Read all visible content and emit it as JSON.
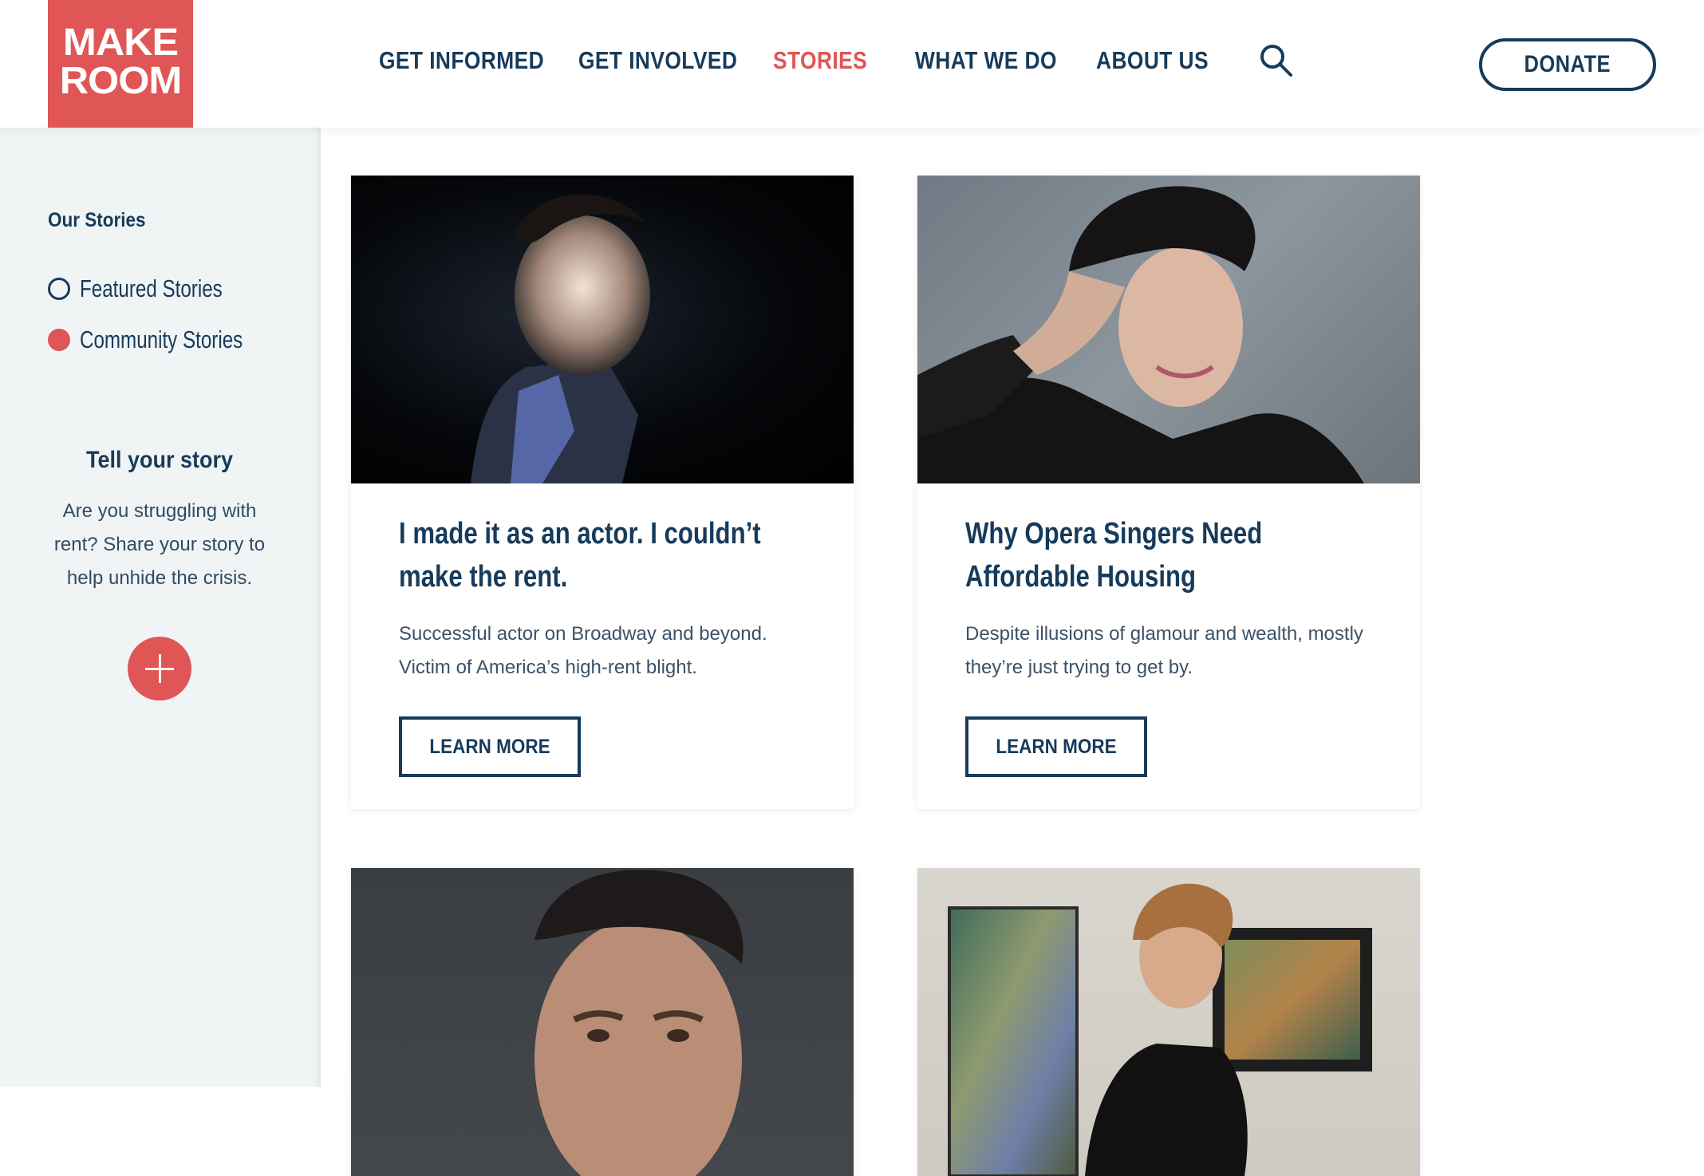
{
  "brand": {
    "logo_line1": "MAKE",
    "logo_line2": "ROOM",
    "accent_color": "#e05555",
    "navy_color": "#173b5a"
  },
  "nav": {
    "items": [
      {
        "label": "GET INFORMED",
        "active": false
      },
      {
        "label": "GET INVOLVED",
        "active": false
      },
      {
        "label": "STORIES",
        "active": true
      },
      {
        "label": "WHAT WE DO",
        "active": false
      },
      {
        "label": "ABOUT US",
        "active": false
      }
    ],
    "search_icon": "search-icon",
    "donate_label": "DONATE"
  },
  "sidebar": {
    "title": "Our Stories",
    "filters": [
      {
        "label": "Featured Stories",
        "selected": false
      },
      {
        "label": "Community Stories",
        "selected": true
      }
    ],
    "tell": {
      "title": "Tell your story",
      "text": "Are you struggling with rent? Share your story to help unhide the crisis.",
      "add_icon": "plus-icon"
    }
  },
  "stories": [
    {
      "title": "I made it as an actor. I couldn’t make the rent.",
      "description": "Successful actor on Broadway and beyond. Victim of America’s high-rent blight.",
      "button": "LEARN MORE"
    },
    {
      "title": "Why Opera Singers Need Affordable Housing",
      "description": "Despite illusions of glamour and wealth, mostly they’re just trying to get by.",
      "button": "LEARN MORE"
    }
  ]
}
